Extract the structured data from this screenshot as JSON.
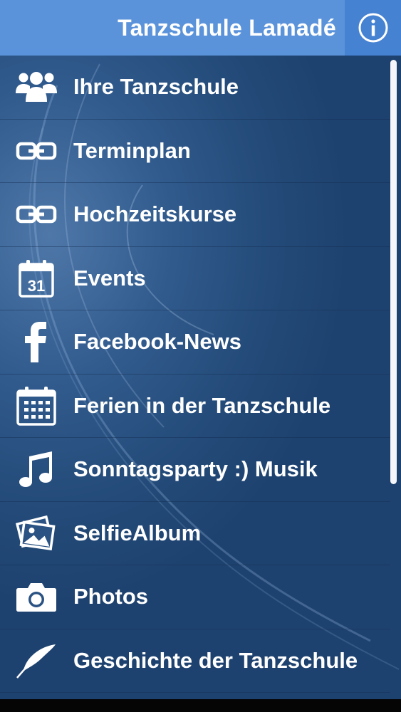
{
  "header": {
    "title": "Tanzschule Lamadé",
    "info_icon": "info-icon"
  },
  "menu": {
    "items": [
      {
        "label": "Ihre Tanzschule",
        "icon": "group-icon"
      },
      {
        "label": "Terminplan",
        "icon": "link-icon"
      },
      {
        "label": "Hochzeitskurse",
        "icon": "link-icon"
      },
      {
        "label": "Events",
        "icon": "calendar-31-icon",
        "icon_text": "31"
      },
      {
        "label": "Facebook-News",
        "icon": "facebook-icon"
      },
      {
        "label": "Ferien in der Tanzschule",
        "icon": "calendar-grid-icon"
      },
      {
        "label": "Sonntagsparty :) Musik",
        "icon": "music-note-icon"
      },
      {
        "label": "SelfieAlbum",
        "icon": "photo-album-icon"
      },
      {
        "label": "Photos",
        "icon": "camera-icon"
      },
      {
        "label": "Geschichte der Tanzschule",
        "icon": "feather-icon"
      }
    ]
  },
  "colors": {
    "header_bg": "#5b93db",
    "info_bg": "#4682d2",
    "menu_bg": "#2a5283",
    "text": "#ffffff"
  }
}
